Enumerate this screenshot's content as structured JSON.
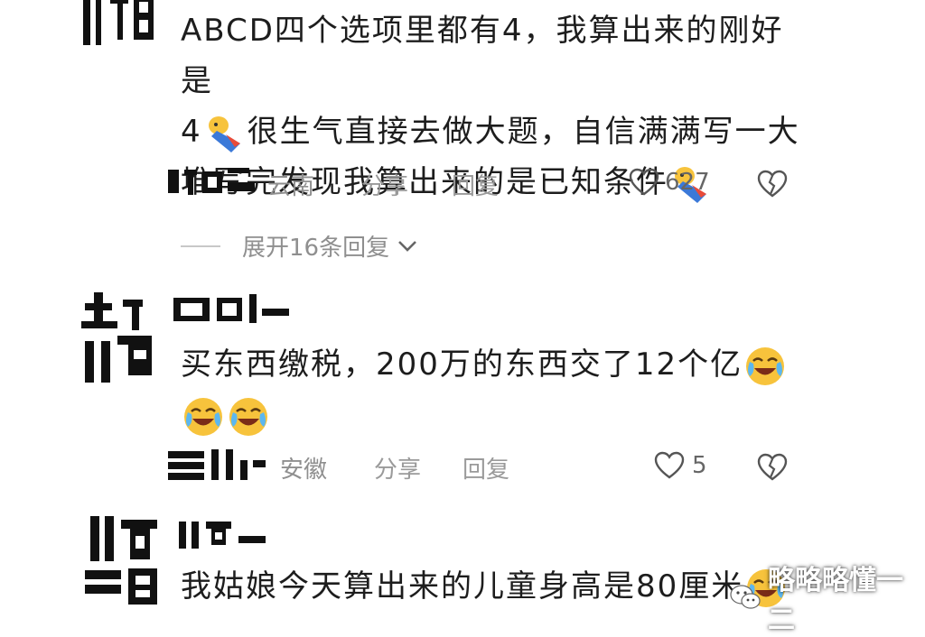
{
  "comments": [
    {
      "text_lines": [
        "ABCD四个选项里都有4，我算出来的刚好是",
        "4",
        "很生气直接去做大题，自信满满写一大",
        "堆写完发现我算出来的是已知条件"
      ],
      "location": "云南",
      "share_label": "分享",
      "reply_label": "回复",
      "likes": "627",
      "expand_label": "展开16条回复"
    },
    {
      "text_line1": "买东西缴税，200万的东西交了12个亿",
      "location": "安徽",
      "share_label": "分享",
      "reply_label": "回复",
      "likes": "5"
    },
    {
      "text_line1": "我姑娘今天算出来的儿童身高是80厘米"
    }
  ],
  "watermark": {
    "text": "略略略懂一二"
  },
  "colors": {
    "text": "#1d1d1d",
    "meta": "#8f8f8f",
    "emoji_yellow": "#f7c33c"
  }
}
